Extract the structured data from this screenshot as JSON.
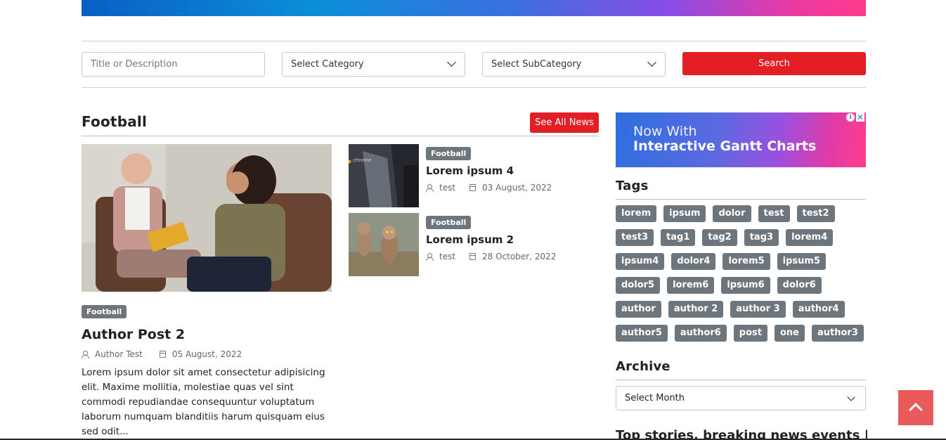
{
  "filters": {
    "title_placeholder": "Title or Description",
    "category_value": "Select Category",
    "subcategory_value": "Select SubCategory",
    "search_label": "Search"
  },
  "section": {
    "title": "Football",
    "see_all_label": "See All News"
  },
  "featured": {
    "badge": "Football",
    "title": "Author Post 2",
    "author": "Author Test",
    "date": "05 August, 2022",
    "excerpt": "Lorem ipsum dolor sit amet consectetur adipisicing elit. Maxime mollitia, molestiae quas vel sint commodi repudiandae consequuntur voluptatum laborum numquam blanditiis harum quisquam eius sed odit..."
  },
  "side_posts": [
    {
      "badge": "Football",
      "title": "Lorem ipsum 4",
      "author": "test",
      "date": "03 August, 2022",
      "thumb_text": "chrome"
    },
    {
      "badge": "Football",
      "title": "Lorem ipsum 2",
      "author": "test",
      "date": "28 October, 2022"
    }
  ],
  "ad": {
    "line1": "Now With",
    "line2": "Interactive Gantt Charts",
    "info_symbol": "i",
    "close_symbol": "✕"
  },
  "tags_section": {
    "title": "Tags",
    "items": [
      "lorem",
      "ipsum",
      "dolor",
      "test",
      "test2",
      "test3",
      "tag1",
      "tag2",
      "tag3",
      "lorem4",
      "ipsum4",
      "dolor4",
      "lorem5",
      "ipsum5",
      "dolor5",
      "lorem6",
      "ipsum6",
      "dolor6",
      "author",
      "author 2",
      "author 3",
      "author4",
      "author5",
      "author6",
      "post",
      "one",
      "author3"
    ]
  },
  "archive": {
    "title": "Archive",
    "select_value": "Select Month"
  },
  "top_stories_title": "Top stories, breaking news events |",
  "colors": {
    "accent_red": "#e31e24",
    "badge_gray": "#6d757d",
    "scroll_top": "#e95b5b"
  }
}
